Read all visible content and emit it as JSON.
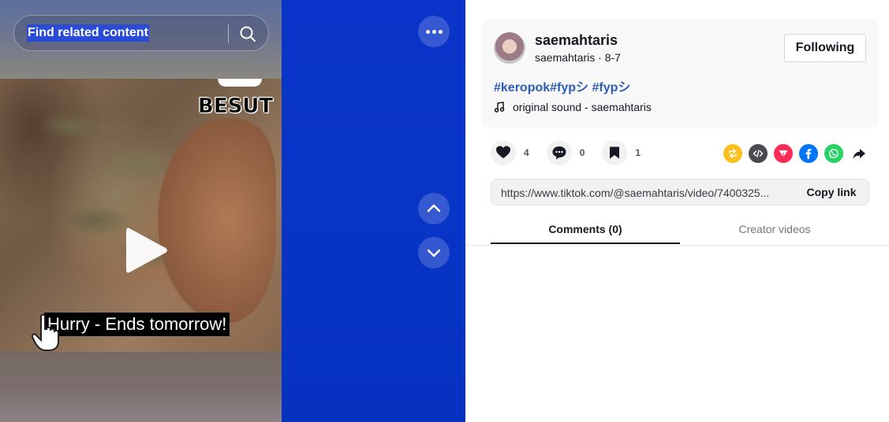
{
  "search": {
    "label": "Find related content"
  },
  "video": {
    "overlay_text": "BESUT",
    "promo_banner": "Hurry - Ends tomorrow!"
  },
  "post": {
    "username": "saemahtaris",
    "handle": "saemahtaris",
    "date": "8-7",
    "follow_label": "Following",
    "hashtags": "#keropok#fypシ #fypシ",
    "sound": "original sound - saemahtaris"
  },
  "stats": {
    "likes": "4",
    "comments": "0",
    "saves": "1"
  },
  "share": {
    "link": "https://www.tiktok.com/@saemahtaris/video/7400325...",
    "copy_label": "Copy link",
    "icons": [
      "repost-icon",
      "embed-icon",
      "send-icon",
      "facebook-icon",
      "whatsapp-icon",
      "share-arrow-icon"
    ],
    "colors": {
      "repost": "#fcc11c",
      "embed": "#4a4a52",
      "send": "#fe2c55",
      "facebook": "#0075fa",
      "whatsapp": "#25d366"
    }
  },
  "tabs": [
    {
      "label": "Comments (0)",
      "active": true
    },
    {
      "label": "Creator videos",
      "active": false
    }
  ],
  "colors": {
    "accent_blue": "#2b5db9",
    "video_bg": "#0a2fbd"
  }
}
